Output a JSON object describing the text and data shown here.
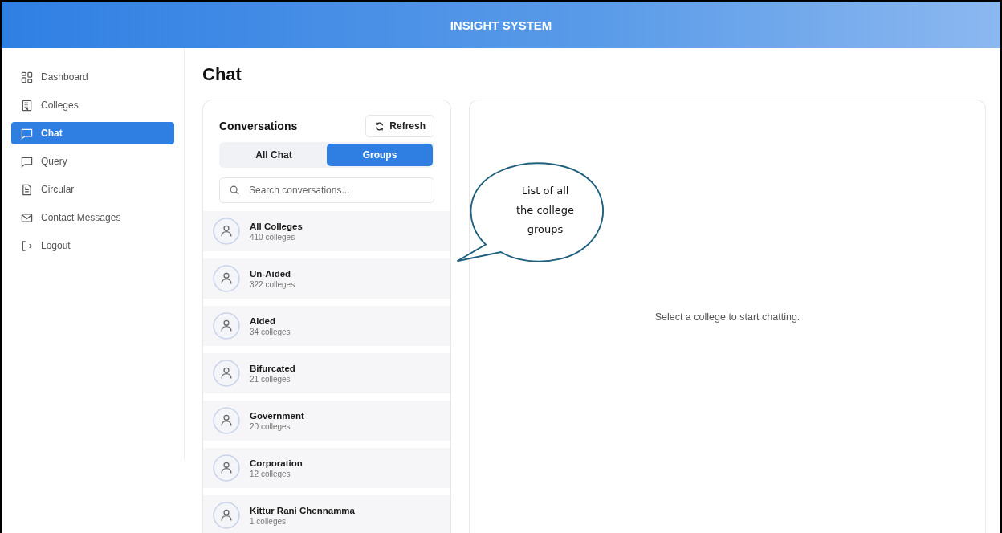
{
  "header": {
    "title": "INSIGHT SYSTEM"
  },
  "sidebar": {
    "items": [
      {
        "label": "Dashboard",
        "kind": "grid",
        "selected": false
      },
      {
        "label": "Colleges",
        "kind": "building",
        "selected": false
      },
      {
        "label": "Chat",
        "kind": "chat",
        "selected": true
      },
      {
        "label": "Query",
        "kind": "chat",
        "selected": false
      },
      {
        "label": "Circular",
        "kind": "document",
        "selected": false
      },
      {
        "label": "Contact Messages",
        "kind": "mail",
        "selected": false
      },
      {
        "label": "Logout",
        "kind": "logout",
        "selected": false
      }
    ]
  },
  "page_title": "Chat",
  "conversations": {
    "title": "Conversations",
    "refresh_button": "Refresh",
    "tabs": [
      {
        "label": "All Chat",
        "selected": false
      },
      {
        "label": "Groups",
        "selected": true
      }
    ],
    "search": {
      "placeholder": "Search conversations..."
    },
    "groups": [
      {
        "name": "All Colleges",
        "count": "410 colleges"
      },
      {
        "name": "Un-Aided",
        "count": "322 colleges"
      },
      {
        "name": "Aided",
        "count": "34 colleges"
      },
      {
        "name": "Bifurcated",
        "count": "21 colleges"
      },
      {
        "name": "Government",
        "count": "20 colleges"
      },
      {
        "name": "Corporation",
        "count": "12 colleges"
      },
      {
        "name": "Kittur Rani Chennamma",
        "count": "1 colleges"
      }
    ]
  },
  "chat_panel": {
    "empty_message": "Select a college to start chatting."
  },
  "callout": {
    "text": "List of all the college groups"
  }
}
